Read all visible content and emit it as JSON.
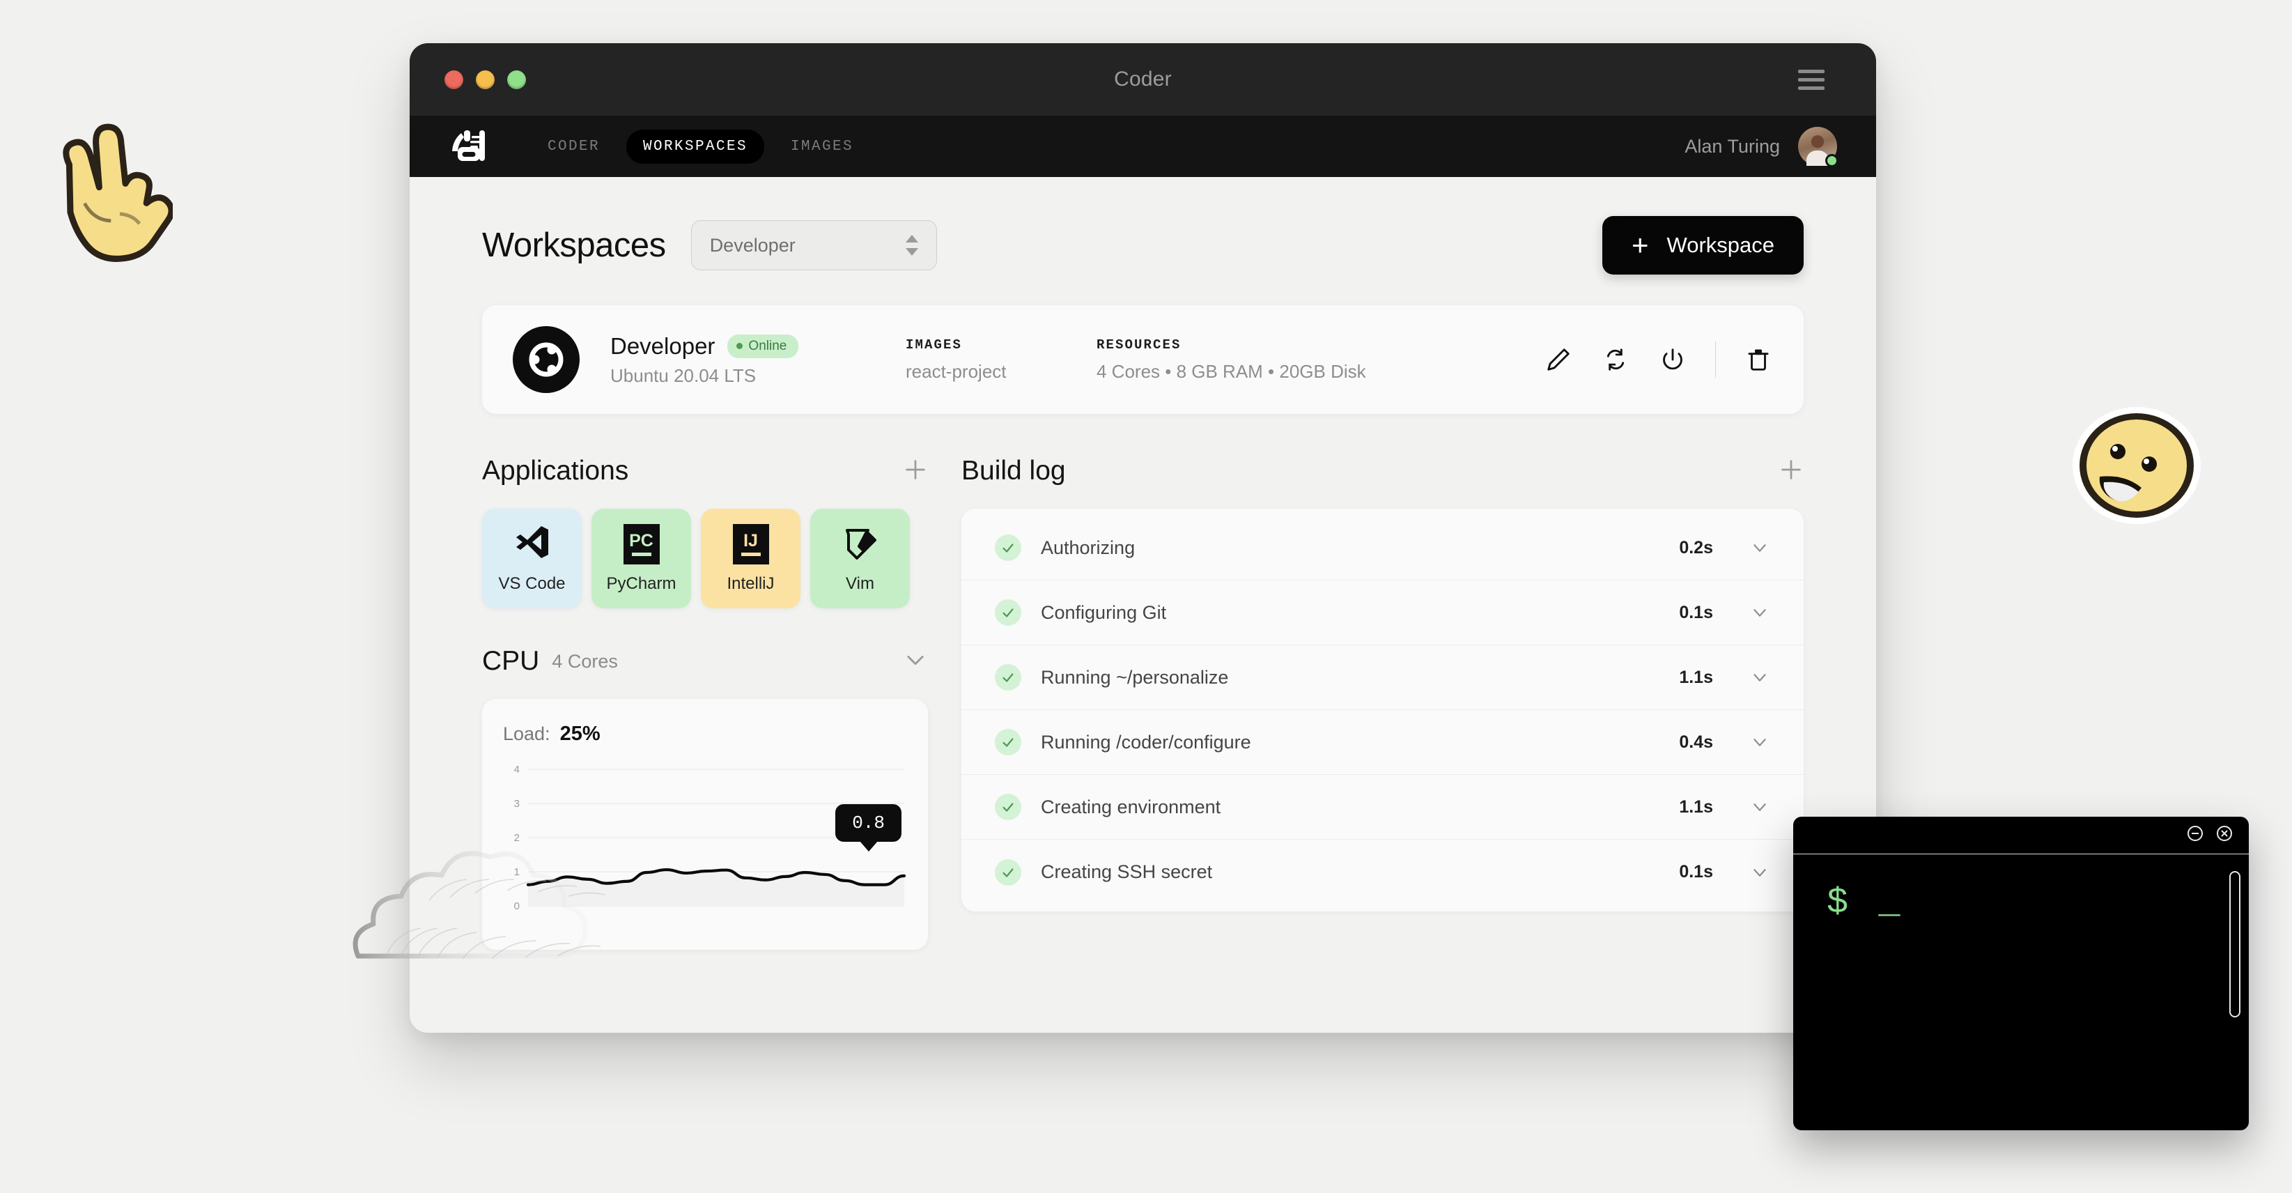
{
  "window": {
    "title": "Coder",
    "menu_icon": "hamburger-icon",
    "lights": [
      "close",
      "minimize",
      "zoom"
    ]
  },
  "topnav": {
    "logo_icon": "coder-logo-icon",
    "items": [
      {
        "label": "CODER",
        "active": false
      },
      {
        "label": "WORKSPACES",
        "active": true
      },
      {
        "label": "IMAGES",
        "active": false
      }
    ],
    "user": {
      "name": "Alan Turing",
      "status": "online",
      "status_color": "#8ade8c"
    }
  },
  "page": {
    "title": "Workspaces",
    "selector": {
      "value": "Developer",
      "icon": "stepper-icon"
    },
    "new_button": {
      "label": "Workspace",
      "icon": "plus-icon"
    }
  },
  "workspace": {
    "logo_icon": "ubuntu-icon",
    "name": "Developer",
    "status_badge": "Online",
    "status_color": "#c9efca",
    "os": "Ubuntu 20.04 LTS",
    "images_label": "IMAGES",
    "images_value": "react-project",
    "resources_label": "RESOURCES",
    "resources_value": "4 Cores • 8 GB RAM • 20GB Disk",
    "actions": [
      {
        "name": "edit-icon"
      },
      {
        "name": "refresh-icon"
      },
      {
        "name": "power-icon"
      },
      {
        "name": "delete-icon"
      }
    ]
  },
  "applications": {
    "title": "Applications",
    "add_icon": "plus-icon",
    "items": [
      {
        "label": "VS Code",
        "bg": "#dbeef5",
        "logo": "vscode-icon",
        "mark": "",
        "accent": "#0e0e0e"
      },
      {
        "label": "PyCharm",
        "bg": "#c5eec6",
        "logo": "pycharm-icon",
        "mark": "PC",
        "accent": "#c5eec6"
      },
      {
        "label": "IntelliJ",
        "bg": "#fbe2a3",
        "logo": "intellij-icon",
        "mark": "IJ",
        "accent": "#fbe2a3"
      },
      {
        "label": "Vim",
        "bg": "#c5eec6",
        "logo": "vim-icon",
        "mark": "",
        "accent": "#0e0e0e"
      }
    ]
  },
  "cpu": {
    "title": "CPU",
    "subtitle": "4 Cores",
    "collapse_icon": "chevron-down-icon",
    "load_label": "Load:",
    "load_value": "25%",
    "tooltip_value": "0.8"
  },
  "chart_data": {
    "type": "line",
    "title": "CPU Load",
    "xlabel": "",
    "ylabel": "",
    "ylim": [
      0,
      4
    ],
    "yticks": [
      0,
      1,
      2,
      3,
      4
    ],
    "grid": true,
    "legend": "none",
    "annotations": [
      {
        "label": "0.8",
        "x": 19,
        "y": 0.8
      }
    ],
    "x": [
      0,
      1,
      2,
      3,
      4,
      5,
      6,
      7,
      8,
      9,
      10,
      11,
      12,
      13,
      14,
      15,
      16,
      17,
      18,
      19
    ],
    "series": [
      {
        "name": "load",
        "color": "#0a0a0a",
        "values": [
          0.62,
          0.72,
          0.85,
          0.78,
          0.66,
          0.72,
          0.98,
          1.06,
          0.96,
          1.02,
          1.05,
          0.82,
          0.76,
          0.86,
          0.98,
          0.92,
          0.74,
          0.62,
          0.62,
          0.88
        ]
      }
    ]
  },
  "build_log": {
    "title": "Build log",
    "add_icon": "plus-icon",
    "columns": [
      "step",
      "duration"
    ],
    "entries": [
      {
        "status": "success",
        "name": "Authorizing",
        "duration": "0.2s"
      },
      {
        "status": "success",
        "name": "Configuring Git",
        "duration": "0.1s"
      },
      {
        "status": "success",
        "name": "Running ~/personalize",
        "duration": "1.1s"
      },
      {
        "status": "success",
        "name": "Running /coder/configure",
        "duration": "0.4s"
      },
      {
        "status": "success",
        "name": "Creating environment",
        "duration": "1.1s"
      },
      {
        "status": "success",
        "name": "Creating SSH secret",
        "duration": "0.1s"
      }
    ]
  },
  "terminal": {
    "minimize_icon": "minimize-circle-icon",
    "close_icon": "close-circle-icon",
    "prompt": "$ _",
    "prompt_color": "#8adc8c"
  },
  "stickers": [
    {
      "name": "rock-hand-sticker"
    },
    {
      "name": "awesome-face-sticker"
    },
    {
      "name": "cloud-sketch-sticker"
    }
  ]
}
